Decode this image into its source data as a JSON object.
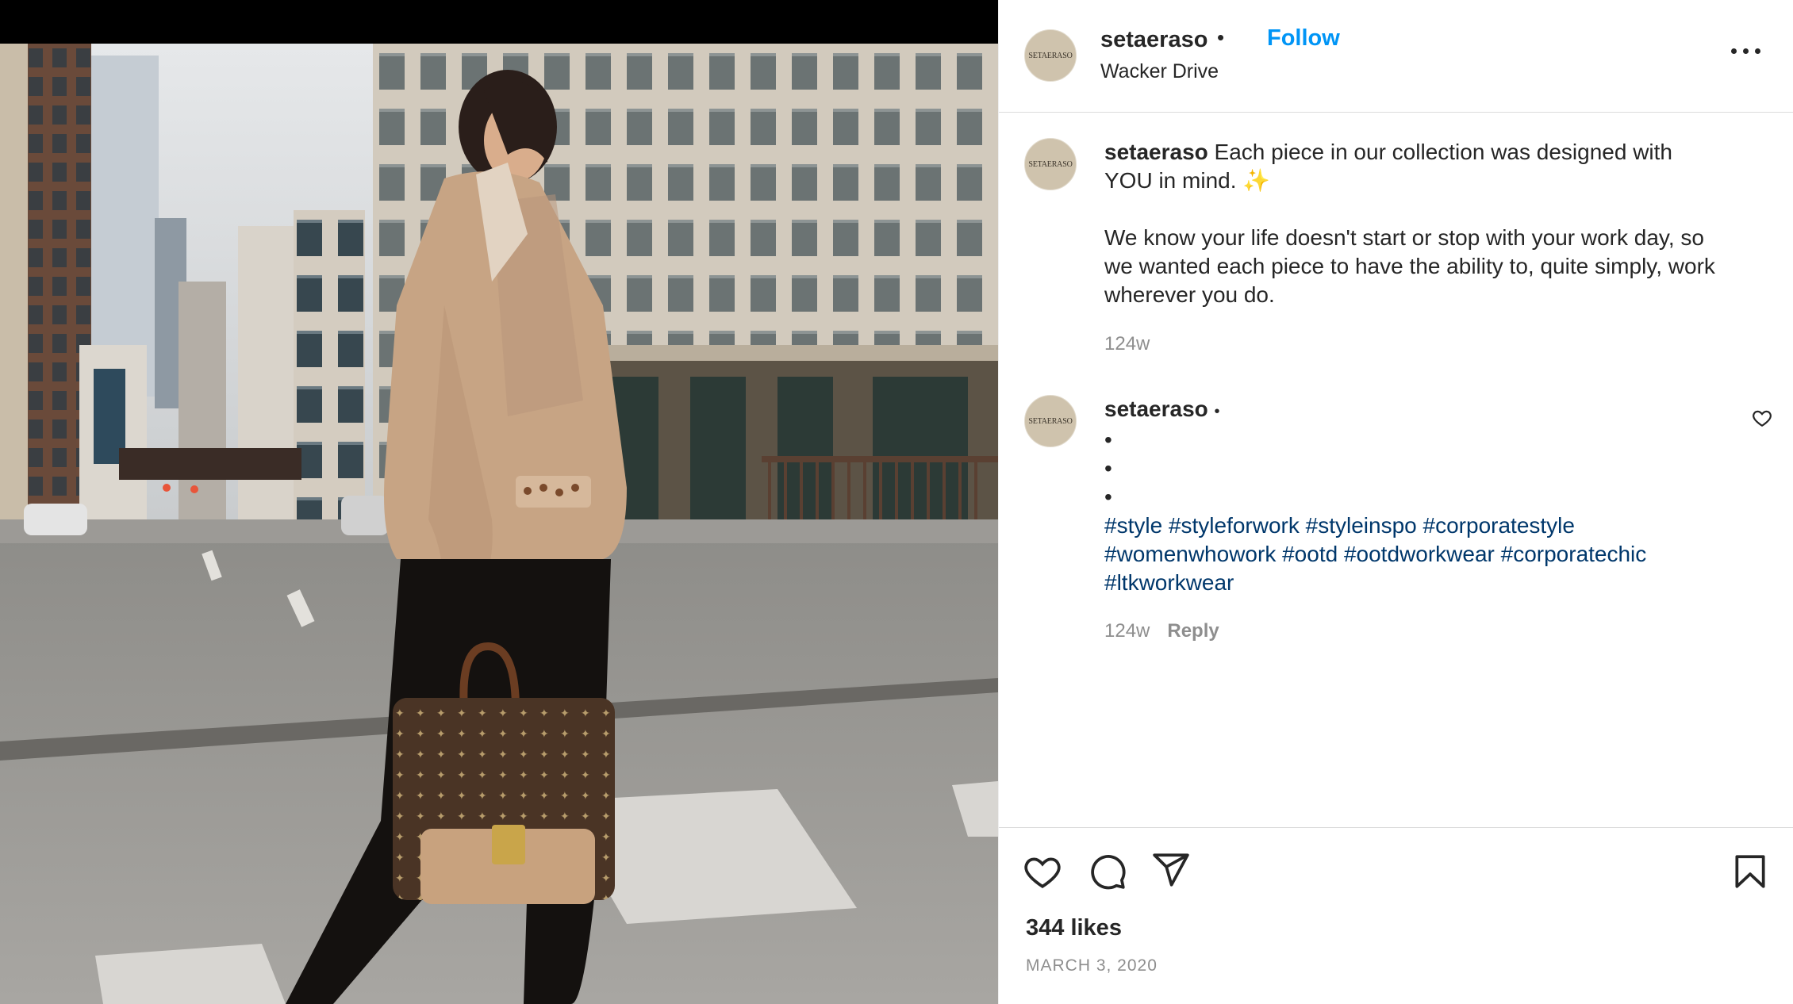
{
  "post": {
    "username": "setaeraso",
    "avatar_text": "SETAERASO",
    "follow_label": "Follow",
    "header_separator": "•",
    "location": "Wacker Drive",
    "more_icon": "more-horizontal-icon"
  },
  "caption": {
    "username": "setaeraso",
    "line1": "Each piece in our collection was designed with YOU in mind. ✨",
    "line2": "We know your life doesn't start or stop with your work day, so we wanted each piece to have the ability to, quite simply, work wherever you do.",
    "time": "124w"
  },
  "comment": {
    "username": "setaeraso",
    "separator": "•",
    "dots": [
      "•",
      "•",
      "•"
    ],
    "hashtags": [
      "#style",
      "#styleforwork",
      "#styleinspo",
      "#corporatestyle",
      "#womenwhowork",
      "#ootd",
      "#ootdworkwear",
      "#corporatechic",
      "#ltkworkwear"
    ],
    "time": "124w",
    "reply_label": "Reply"
  },
  "actions": {
    "icons": [
      "heart-icon",
      "comment-icon",
      "share-icon",
      "bookmark-icon"
    ],
    "likes": "344 likes",
    "date": "MARCH 3, 2020"
  },
  "colors": {
    "link_blue": "#0095f6",
    "hashtag": "#00376b",
    "muted": "#8e8e8e",
    "text": "#262626"
  }
}
